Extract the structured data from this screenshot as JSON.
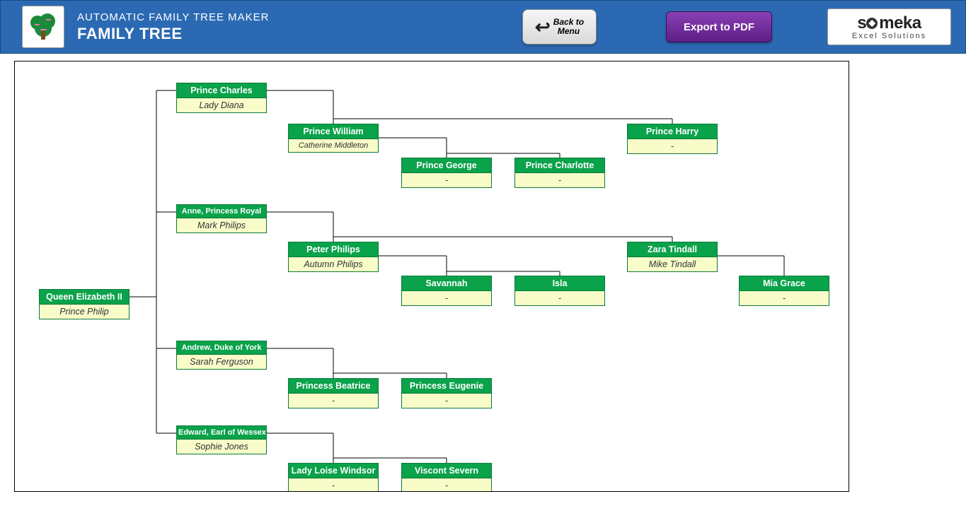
{
  "header": {
    "subtitle": "AUTOMATIC FAMILY TREE MAKER",
    "title": "FAMILY TREE",
    "back_line1": "Back to",
    "back_line2": "Menu",
    "export_label": "Export to PDF",
    "brand_name": "someka",
    "brand_sub": "Excel Solutions"
  },
  "tree": {
    "root": {
      "name": "Queen Elizabeth II",
      "spouse": "Prince Philip"
    },
    "level1": [
      {
        "name": "Prince Charles",
        "spouse": "Lady Diana"
      },
      {
        "name": "Anne, Princess Royal",
        "spouse": "Mark Philips"
      },
      {
        "name": "Andrew, Duke of York",
        "spouse": "Sarah Ferguson"
      },
      {
        "name": "Edward, Earl of Wessex",
        "spouse": "Sophie Jones"
      }
    ],
    "level2": [
      {
        "name": "Prince William",
        "spouse": "Catherine Middleton"
      },
      {
        "name": "Prince Harry",
        "spouse": "-"
      },
      {
        "name": "Peter Philips",
        "spouse": "Autumn Philips"
      },
      {
        "name": "Zara Tindall",
        "spouse": "Mike Tindall"
      },
      {
        "name": "Princess Beatrice",
        "spouse": "-"
      },
      {
        "name": "Princess Eugenie",
        "spouse": "-"
      },
      {
        "name": "Lady Loise Windsor",
        "spouse": "-"
      },
      {
        "name": "Viscont Severn",
        "spouse": "-"
      }
    ],
    "level3": [
      {
        "name": "Prince George",
        "spouse": "-"
      },
      {
        "name": "Prince Charlotte",
        "spouse": "-"
      },
      {
        "name": "Savannah",
        "spouse": "-"
      },
      {
        "name": "Isla",
        "spouse": "-"
      },
      {
        "name": "Mia Grace",
        "spouse": "-"
      }
    ]
  }
}
